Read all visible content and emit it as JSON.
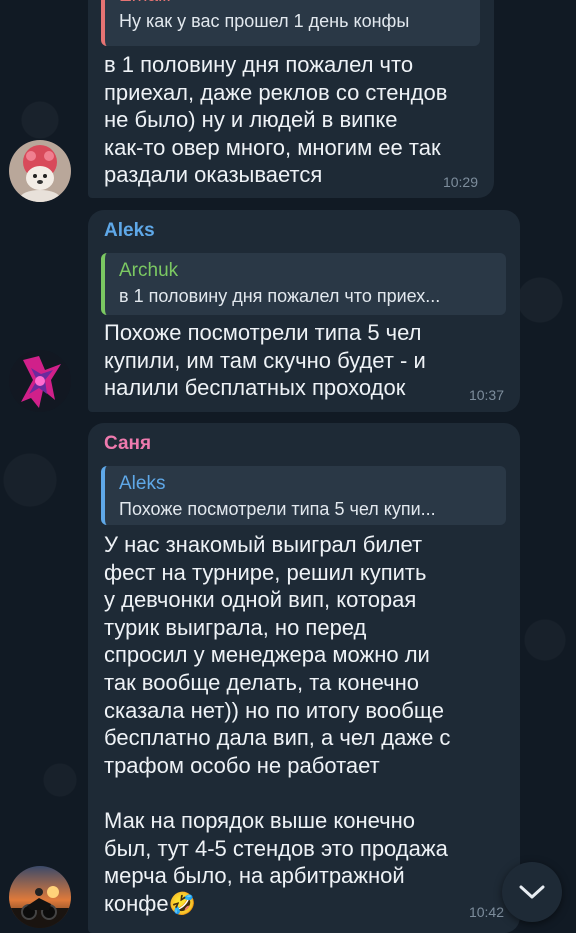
{
  "colors": {
    "background": "#0e1621",
    "bubble": "#1e2a36",
    "reply_bg": "#2a3846",
    "time": "#7d8d9c"
  },
  "messages": [
    {
      "sender": "Emaill",
      "sender_color": "#e57373",
      "reply_text": "Ну как у вас прошел 1 день конфы",
      "reply_color": "#e57373",
      "text": "в 1 половину дня пожалел что\nприехал, даже реклов со стендов\nне было) ну и людей в випке\nкак-то овер много, многим ее так\nраздали оказывается",
      "time": "10:29",
      "avatar_icon": "dog-avatar"
    },
    {
      "sender": "Aleks",
      "sender_color": "#5fa8e8",
      "reply_name": "Archuk",
      "reply_name_color": "#7bc862",
      "reply_text": "в 1 половину дня пожалел что приех...",
      "text": "Похоже посмотрели типа 5 чел\nкупили, им там скучно будет - и\nналили бесплатных проходок",
      "time": "10:37",
      "avatar_icon": "neon-avatar"
    },
    {
      "sender": "Саня",
      "sender_color": "#ee7aae",
      "reply_name": "Aleks",
      "reply_name_color": "#5fa8e8",
      "reply_text": "Похоже посмотрели типа 5 чел купи...",
      "text": "У нас знакомый выиграл билет\nфест на турнире, решил купить\nу девчонки одной вип, которая\nтурик выиграла, но перед\nспросил у менеджера можно ли\nтак вообще делать, та конечно\nсказала нет)) но по итогу вообще\nбесплатно дала вип, а чел даже с\nтрафом особо не работает\n\nМак на порядок выше конечно\nбыл, тут 4-5 стендов это продажа\nмерча было, на арбитражной\nконфе🤣",
      "time": "10:42",
      "avatar_icon": "moto-avatar"
    }
  ],
  "scroll_down_icon": "chevron-down-icon"
}
